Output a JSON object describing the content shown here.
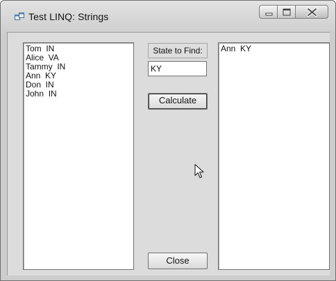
{
  "window": {
    "title": "Test LINQ: Strings"
  },
  "icons": {
    "app": "app-window-icon",
    "minimize": "minimize-icon",
    "maximize": "maximize-icon",
    "close": "close-icon",
    "cursor": "mouse-pointer-icon"
  },
  "source_list": {
    "items": [
      "Tom  IN",
      "Alice  VA",
      "Tammy  IN",
      "Ann  KY",
      "Don  IN",
      "John  IN"
    ]
  },
  "state_label": "State to Find:",
  "state_input": {
    "value": "KY"
  },
  "calculate_label": "Calculate",
  "result_list": {
    "items": [
      "Ann  KY"
    ]
  },
  "close_label": "Close"
}
